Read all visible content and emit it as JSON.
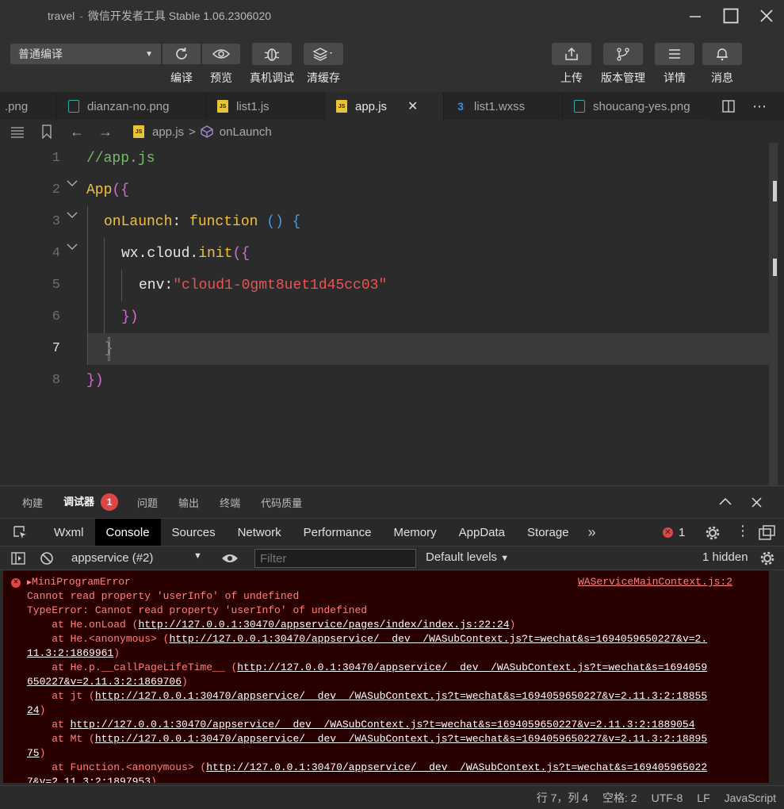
{
  "window": {
    "project": "travel",
    "title": "微信开发者工具 Stable 1.06.2306020"
  },
  "toolbar": {
    "compile_mode": "普通编译",
    "buttons": [
      {
        "label": "编译",
        "icon": "refresh-icon"
      },
      {
        "label": "预览",
        "icon": "eye-icon"
      },
      {
        "label": "真机调试",
        "icon": "bug-icon"
      },
      {
        "label": "清缓存",
        "icon": "layers-icon"
      },
      {
        "label": "上传",
        "icon": "upload-icon"
      },
      {
        "label": "版本管理",
        "icon": "branch-icon"
      },
      {
        "label": "详情",
        "icon": "menu-icon"
      },
      {
        "label": "消息",
        "icon": "bell-icon"
      }
    ]
  },
  "tabs": [
    {
      "label": ".png",
      "type": "png"
    },
    {
      "label": "dianzan-no.png",
      "type": "png"
    },
    {
      "label": "list1.js",
      "type": "js"
    },
    {
      "label": "app.js",
      "type": "js",
      "active": true
    },
    {
      "label": "list1.wxss",
      "type": "css"
    },
    {
      "label": "shoucang-yes.png",
      "type": "png"
    }
  ],
  "breadcrumb": {
    "file": "app.js",
    "symbol": "onLaunch"
  },
  "editor": {
    "line_numbers": [
      "1",
      "2",
      "3",
      "4",
      "5",
      "6",
      "7",
      "8"
    ],
    "current_line": "7",
    "code": {
      "l1": "//app.js",
      "l2_fn": "App",
      "l2_br": "({",
      "l3_key": "onLaunch",
      "l3_colon": ": ",
      "l3_kw": "function",
      "l3_paren": " ()",
      "l3_br": " {",
      "l4_obj": "wx.cloud.",
      "l4_fn": "init",
      "l4_br": "({",
      "l5_key": "env",
      "l5_colon": ":",
      "l5_str": "\"cloud1-0gmt8uet1d45cc03\"",
      "l6": "})",
      "l7": "}",
      "l8": "})"
    }
  },
  "panel": {
    "tabs": [
      "构建",
      "调试器",
      "问题",
      "输出",
      "终端",
      "代码质量"
    ],
    "active_tab": "调试器",
    "badge": "1"
  },
  "devtools": {
    "tabs": [
      "Wxml",
      "Console",
      "Sources",
      "Network",
      "Performance",
      "Memory",
      "AppData",
      "Storage"
    ],
    "active": "Console",
    "more": "»",
    "error_count": "1",
    "context": "appservice (#2)",
    "filter_placeholder": "Filter",
    "levels": "Default levels",
    "hidden": "1 hidden"
  },
  "console": {
    "title": "MiniProgramError",
    "source": "WAServiceMainContext.js:2",
    "msg1": "Cannot read property 'userInfo' of undefined",
    "msg2": "TypeError: Cannot read property 'userInfo' of undefined",
    "s1_pre": "    at He.onLoad (",
    "s1_link": "http://127.0.0.1:30470/appservice/pages/index/index.js:22:24",
    "s1_post": ")",
    "s2_pre": "    at He.<anonymous> (",
    "s2_link": "http://127.0.0.1:30470/appservice/__dev__/WASubContext.js?t=wechat&s=1694059650227&v=2.",
    "s2_link_b": "11.3:2:1869961",
    "s2_post": ")",
    "s3_pre": "    at He.p.__callPageLifeTime__ (",
    "s3_link": "http://127.0.0.1:30470/appservice/__dev__/WASubContext.js?t=wechat&s=1694059",
    "s3_link_b": "650227&v=2.11.3:2:1869706",
    "s3_post": ")",
    "s4_pre": "    at jt (",
    "s4_link": "http://127.0.0.1:30470/appservice/__dev__/WASubContext.js?t=wechat&s=1694059650227&v=2.11.3:2:18855",
    "s4_link_b": "24",
    "s4_post": ")",
    "s5_pre": "    at ",
    "s5_link": "http://127.0.0.1:30470/appservice/__dev__/WASubContext.js?t=wechat&s=1694059650227&v=2.11.3:2:1889054",
    "s6_pre": "    at Mt (",
    "s6_link": "http://127.0.0.1:30470/appservice/__dev__/WASubContext.js?t=wechat&s=1694059650227&v=2.11.3:2:18895",
    "s6_link_b": "75",
    "s6_post": ")",
    "s7_pre": "    at Function.<anonymous> (",
    "s7_link": "http://127.0.0.1:30470/appservice/__dev__/WASubContext.js?t=wechat&s=169405965022",
    "s7_link_b": "7&v=2.11.3:2:1897953",
    "s7_post": ")"
  },
  "status": {
    "position": "行 7，列 4",
    "indent": "空格: 2",
    "encoding": "UTF-8",
    "eol": "LF",
    "language": "JavaScript"
  },
  "colors": {
    "background": "#2b2b2b",
    "console_error_bg": "#290000",
    "error_text": "#ff8080",
    "badge": "#e04545"
  }
}
